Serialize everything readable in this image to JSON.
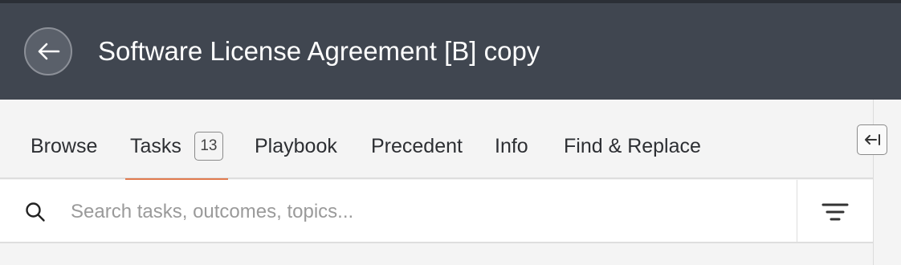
{
  "header": {
    "title": "Software License Agreement [B] copy",
    "back_icon": "arrow-left-icon"
  },
  "tabs": [
    {
      "label": "Browse",
      "active": false
    },
    {
      "label": "Tasks",
      "active": true,
      "badge": "13"
    },
    {
      "label": "Playbook",
      "active": false
    },
    {
      "label": "Precedent",
      "active": false
    },
    {
      "label": "Info",
      "active": false
    },
    {
      "label": "Find & Replace",
      "active": false
    }
  ],
  "collapse_icon": "collapse-panel-icon",
  "search": {
    "placeholder": "Search tasks, outcomes, topics...",
    "value": "",
    "icon": "search-icon",
    "filter_icon": "filter-icon"
  },
  "colors": {
    "header_bg": "#404650",
    "active_tab_accent": "#e07a4e",
    "panel_bg": "#f4f4f4"
  }
}
